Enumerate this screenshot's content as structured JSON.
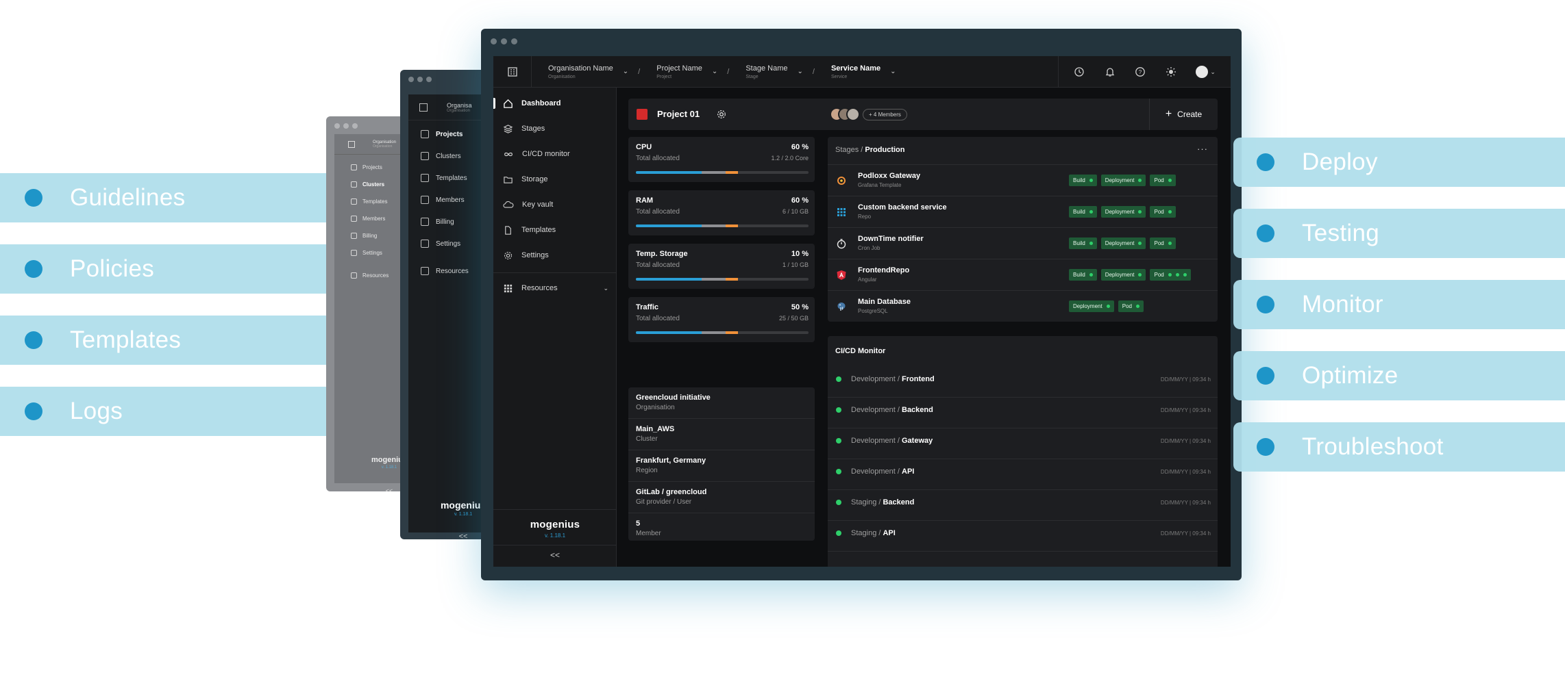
{
  "left_features": [
    "Guidelines",
    "Policies",
    "Templates",
    "Logs"
  ],
  "right_features": [
    "Deploy",
    "Testing",
    "Monitor",
    "Optimize",
    "Troubleshoot"
  ],
  "back_window_2": {
    "crumb_title": "Organisa",
    "crumb_sub": "Organisation",
    "nav": [
      "Projects",
      "Clusters",
      "Templates",
      "Members",
      "Billing",
      "Settings",
      "Resources"
    ],
    "brand": "mogenius",
    "version": "v. 1.18.1",
    "collapse": "<<"
  },
  "back_window_3": {
    "crumb_title": "Organisation",
    "crumb_sub": "Organisation",
    "nav": [
      "Projects",
      "Clusters",
      "Templates",
      "Members",
      "Billing",
      "Settings",
      "Resources"
    ],
    "brand": "mogenius",
    "version": "v. 1.18.1",
    "collapse": "<<"
  },
  "topbar": {
    "crumbs": [
      {
        "title": "Organisation Name",
        "sub": "Organisation"
      },
      {
        "title": "Project Name",
        "sub": "Project"
      },
      {
        "title": "Stage Name",
        "sub": "Stage"
      },
      {
        "title": "Service Name",
        "sub": "Service"
      }
    ],
    "separator": "/"
  },
  "nav": {
    "items": [
      {
        "label": "Dashboard",
        "icon": "home-icon"
      },
      {
        "label": "Stages",
        "icon": "layers-icon"
      },
      {
        "label": "CI/CD monitor",
        "icon": "infinity-icon"
      },
      {
        "label": "Storage",
        "icon": "folder-icon"
      },
      {
        "label": "Key vault",
        "icon": "cloud-lock-icon"
      },
      {
        "label": "Templates",
        "icon": "document-icon"
      },
      {
        "label": "Settings",
        "icon": "gear-icon"
      }
    ],
    "resources": "Resources",
    "brand": "mogenius",
    "version": "v. 1.18.1",
    "collapse": "<<"
  },
  "project": {
    "name": "Project 01",
    "color": "#d42b2b",
    "members": "+ 4 Members",
    "create_label": "Create"
  },
  "metrics": [
    {
      "name": "CPU",
      "percent": "60 %",
      "sub": "Total allocated",
      "value": "1.2 / 2.0 Core",
      "fill": [
        0.38,
        0.14,
        0.07
      ]
    },
    {
      "name": "RAM",
      "percent": "60 %",
      "sub": "Total allocated",
      "value": "6 / 10 GB",
      "fill": [
        0.38,
        0.14,
        0.07
      ]
    },
    {
      "name": "Temp. Storage",
      "percent": "10 %",
      "sub": "Total allocated",
      "value": "1 / 10 GB",
      "fill": [
        0.38,
        0.14,
        0.07
      ]
    },
    {
      "name": "Traffic",
      "percent": "50 %",
      "sub": "Total allocated",
      "value": "25 / 50 GB",
      "fill": [
        0.38,
        0.14,
        0.07
      ]
    }
  ],
  "info": [
    {
      "title": "Greencloud initiative",
      "sub": "Organisation"
    },
    {
      "title": "Main_AWS",
      "sub": "Cluster"
    },
    {
      "title": "Frankfurt, Germany",
      "sub": "Region"
    },
    {
      "title": "GitLab / greencloud",
      "sub": "Git provider / User"
    },
    {
      "title": "5",
      "sub": "Member"
    }
  ],
  "stages": {
    "prefix": "Stages /",
    "current": "Production",
    "more": "···",
    "rows": [
      {
        "name": "Podloxx Gateway",
        "sub": "Grafana Template",
        "icon": "grafana-icon",
        "tags": [
          "Build",
          "Deployment",
          "Pod"
        ],
        "pod_dots": 1
      },
      {
        "name": "Custom backend service",
        "sub": "Repo",
        "icon": "grid-icon",
        "tags": [
          "Build",
          "Deployment",
          "Pod"
        ],
        "pod_dots": 1
      },
      {
        "name": "DownTime notifier",
        "sub": "Cron Job",
        "icon": "stopwatch-icon",
        "tags": [
          "Build",
          "Deployment",
          "Pod"
        ],
        "pod_dots": 1
      },
      {
        "name": "FrontendRepo",
        "sub": "Angular",
        "icon": "angular-icon",
        "tags": [
          "Build",
          "Deployment",
          "Pod"
        ],
        "pod_dots": 3
      },
      {
        "name": "Main Database",
        "sub": "PostgreSQL",
        "icon": "postgresql-icon",
        "tags": [
          "Deployment",
          "Pod"
        ],
        "pod_dots": 1
      }
    ]
  },
  "cicd": {
    "title": "CI/CD Monitor",
    "rows": [
      {
        "env": "Development /",
        "service": "Frontend",
        "date": "DD/MM/YY | 09:34 h"
      },
      {
        "env": "Development /",
        "service": "Backend",
        "date": "DD/MM/YY | 09:34 h"
      },
      {
        "env": "Development /",
        "service": "Gateway",
        "date": "DD/MM/YY | 09:34 h"
      },
      {
        "env": "Development /",
        "service": "API",
        "date": "DD/MM/YY | 09:34 h"
      },
      {
        "env": "Staging /",
        "service": "Backend",
        "date": "DD/MM/YY | 09:34 h"
      },
      {
        "env": "Staging /",
        "service": "API",
        "date": "DD/MM/YY | 09:34 h"
      }
    ]
  }
}
